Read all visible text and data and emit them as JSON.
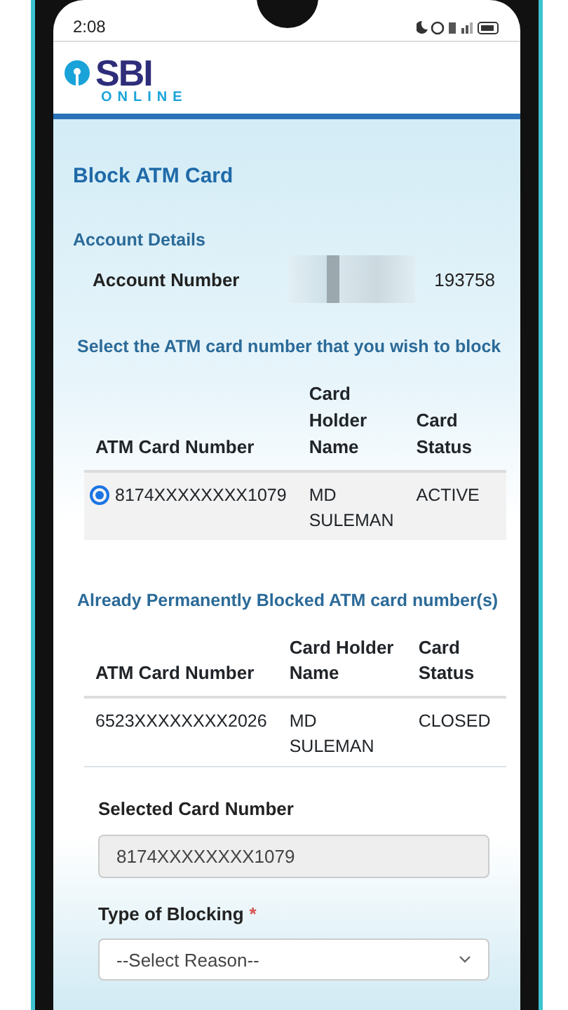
{
  "status_bar": {
    "time": "2:08"
  },
  "header": {
    "brand": "SBI",
    "tagline": "ONLINE"
  },
  "page_title": "Block ATM Card",
  "account_details": {
    "heading": "Account Details",
    "label": "Account Number",
    "value": "193758"
  },
  "select_prompt": "Select the ATM card number that you wish to block",
  "active_cards": {
    "columns": [
      "ATM Card Number",
      "Card Holder Name",
      "Card Status"
    ],
    "rows": [
      {
        "card_number": "8174XXXXXXXX1079",
        "holder": "MD SULEMAN",
        "status": "ACTIVE",
        "selected": true
      }
    ]
  },
  "blocked_heading": "Already Permanently Blocked ATM card number(s)",
  "blocked_cards": {
    "columns": [
      "ATM Card Number",
      "Card Holder Name",
      "Card Status"
    ],
    "rows": [
      {
        "card_number": "6523XXXXXXXX2026",
        "holder": "MD SULEMAN",
        "status": "CLOSED"
      }
    ]
  },
  "selected_card": {
    "label": "Selected Card Number",
    "value": "8174XXXXXXXX1079"
  },
  "blocking_type": {
    "label": "Type of Blocking",
    "required_mark": "*",
    "value": "--Select Reason--"
  }
}
